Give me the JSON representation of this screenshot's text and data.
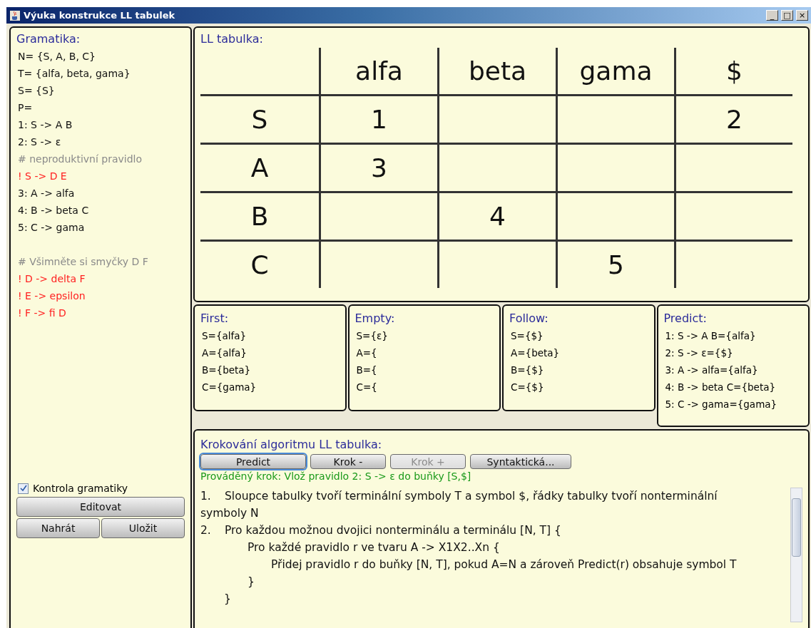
{
  "window": {
    "title": "Výuka konstrukce LL tabulek",
    "controls": [
      "_",
      "□",
      "×"
    ]
  },
  "grammar": {
    "title": "Gramatika:",
    "lines": [
      {
        "kind": "plain",
        "text": "N= {S, A, B, C}"
      },
      {
        "kind": "plain",
        "text": "T= {alfa, beta, gama}"
      },
      {
        "kind": "plain",
        "text": "S= {S}"
      },
      {
        "kind": "plain",
        "text": "P="
      },
      {
        "kind": "plain",
        "text": "1: S -> A B"
      },
      {
        "kind": "plain",
        "text": "2: S -> ε"
      },
      {
        "kind": "comment",
        "text": "# neproduktivní pravidlo"
      },
      {
        "kind": "error",
        "text": "! S -> D E"
      },
      {
        "kind": "plain",
        "text": "3: A -> alfa"
      },
      {
        "kind": "plain",
        "text": "4: B -> beta C"
      },
      {
        "kind": "plain",
        "text": "5: C -> gama"
      },
      {
        "kind": "blank"
      },
      {
        "kind": "comment",
        "text": "# Všimněte si smyčky D F"
      },
      {
        "kind": "error",
        "text": "! D -> delta F"
      },
      {
        "kind": "error",
        "text": "! E -> epsilon"
      },
      {
        "kind": "error",
        "text": "! F -> fi D"
      }
    ],
    "check": {
      "label": "Kontrola gramatiky",
      "checked": true
    },
    "button_rows": [
      [
        "Editovat"
      ],
      [
        "Nahrát",
        "Uložit"
      ]
    ]
  },
  "ll_table": {
    "title": "LL tabulka:",
    "columns": [
      "alfa",
      "beta",
      "gama",
      "$"
    ],
    "rows": [
      {
        "head": "S",
        "cells": [
          "1",
          "",
          "",
          "2"
        ]
      },
      {
        "head": "A",
        "cells": [
          "3",
          "",
          "",
          ""
        ]
      },
      {
        "head": "B",
        "cells": [
          "",
          "4",
          "",
          ""
        ]
      },
      {
        "head": "C",
        "cells": [
          "",
          "",
          "5",
          ""
        ]
      }
    ]
  },
  "sets": [
    {
      "title": "First:",
      "lines": [
        "S={alfa}",
        "A={alfa}",
        "B={beta}",
        "C={gama}"
      ]
    },
    {
      "title": "Empty:",
      "lines": [
        "S={ε}",
        "A={",
        "B={",
        "C={"
      ]
    },
    {
      "title": "Follow:",
      "lines": [
        "S={$}",
        "A={beta}",
        "B={$}",
        "C={$}"
      ]
    },
    {
      "title": "Predict:",
      "lines": [
        "1: S -> A B={alfa}",
        "2: S -> ε={$}",
        "3: A -> alfa={alfa}",
        "4: B -> beta C={beta}",
        "5: C -> gama={gama}"
      ]
    }
  ],
  "stepping": {
    "title": "Krokování algoritmu LL tabulka:",
    "buttons": [
      {
        "label": "Predict",
        "selected": true,
        "disabled": false
      },
      {
        "label": "Krok -",
        "selected": false,
        "disabled": false
      },
      {
        "label": "Krok +",
        "selected": false,
        "disabled": true
      },
      {
        "label": "Syntaktická...",
        "selected": false,
        "disabled": false
      }
    ],
    "current_step": "Prováděný krok: Vlož pravidlo 2: S -> ε do buňky [S,$]",
    "steps": [
      {
        "number": "1.",
        "text": "Sloupce tabulky tvoří terminální symboly T a symbol $, řádky tabulky tvoří nonterminální symboly N"
      },
      {
        "number": "2.",
        "text": "Pro každou možnou dvojici nonterminálu a terminálu [N, T] {",
        "close": "}",
        "children": [
          {
            "text": "Pro každé pravidlo r ve tvaru A -> X1X2..Xn {",
            "close": "}",
            "children": [
              {
                "text": "Přidej pravidlo r do buňky [N, T], pokud A=N a zároveň Predict(r) obsahuje symbol T"
              }
            ]
          }
        ]
      }
    ]
  }
}
